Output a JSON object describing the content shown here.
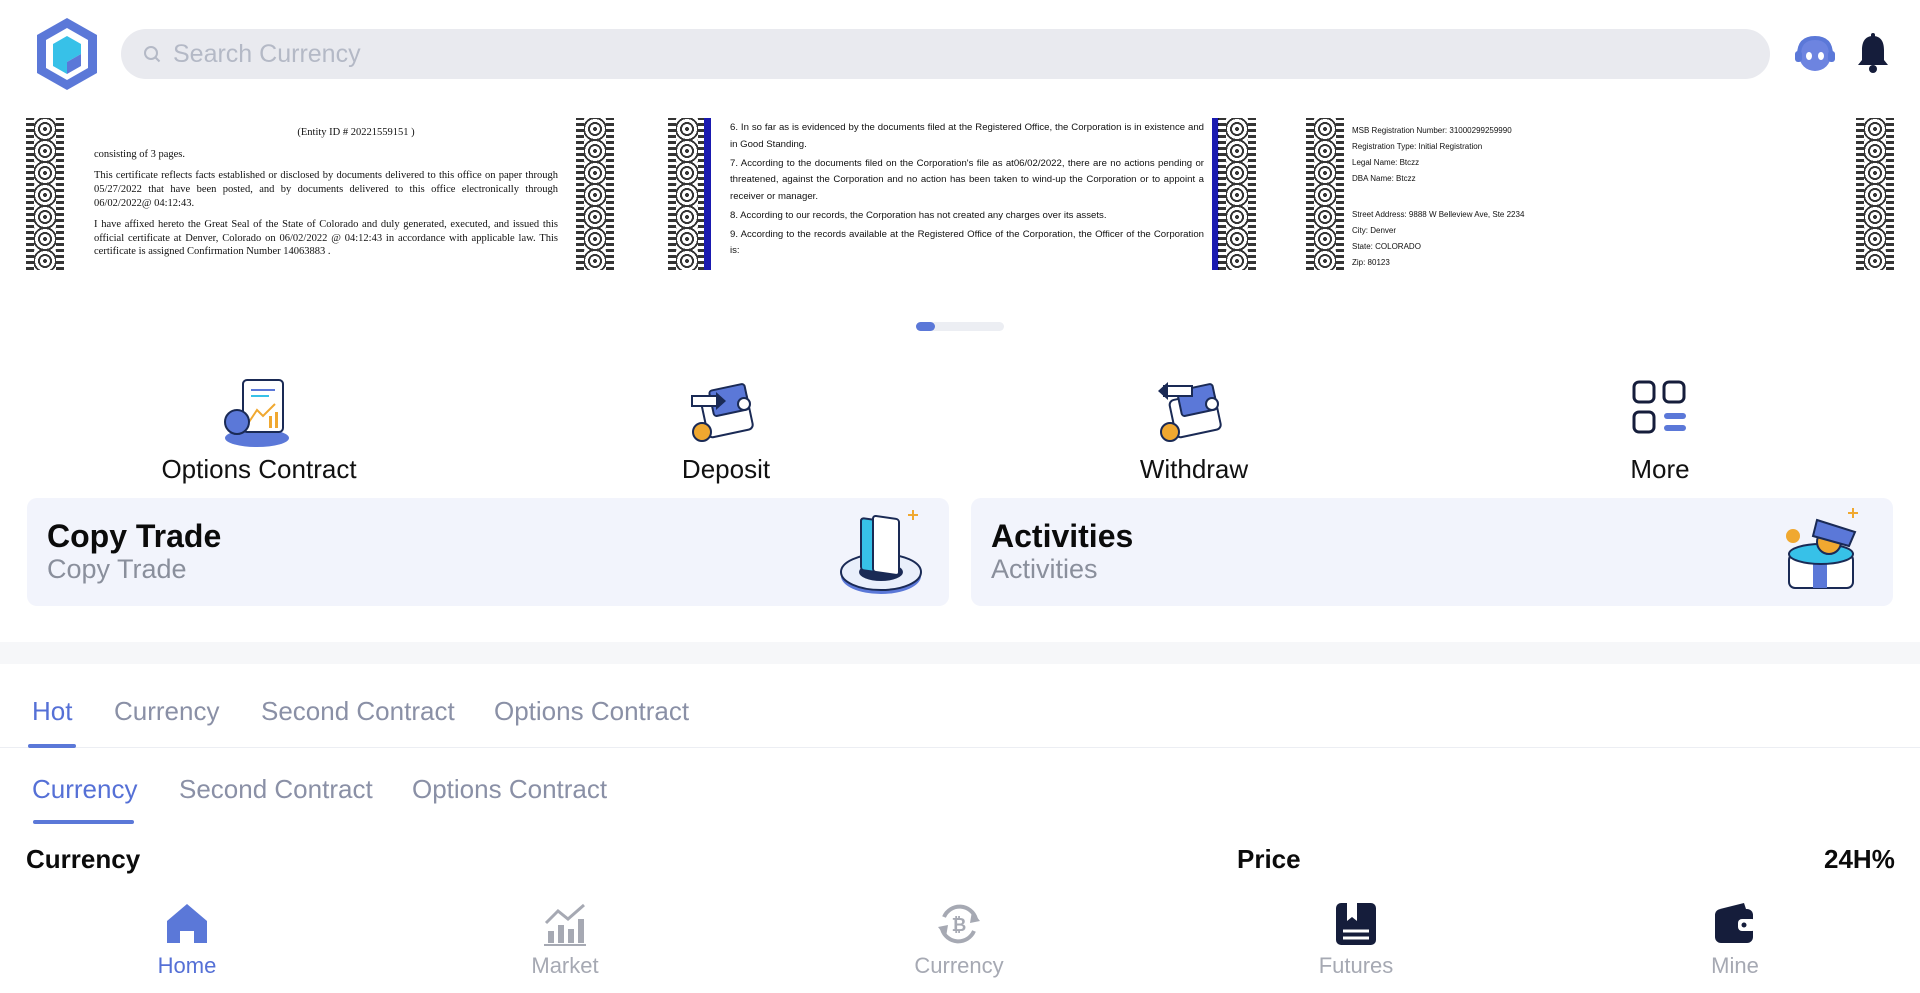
{
  "header": {
    "search_placeholder": "Search Currency"
  },
  "banner": {
    "cert1": {
      "entity_id": "(Entity ID # 20221559151 )",
      "pages": "consisting of 3 pages.",
      "para1": "This certificate reflects facts established or disclosed by documents delivered to this office on paper through 05/27/2022 that have been posted, and by documents delivered to this office electronically through 06/02/2022@ 04:12:43.",
      "para2": "I have affixed hereto the Great Seal of the State of Colorado and duly generated, executed, and issued this official certificate at Denver, Colorado on 06/02/2022 @ 04:12:43 in accordance with applicable law. This certificate is assigned Confirmation Number 14063883 ."
    },
    "cert2": {
      "item6": "6. In so far as is evidenced by the documents filed at the Registered Office, the Corporation is in existence and in Good Standing.",
      "item7": "7. According to the documents filed on the Corporation's file as at06/02/2022, there are no actions pending or threatened, against the Corporation and no action has been taken to wind-up the Corporation or to appoint a receiver or manager.",
      "item8": "8. According to our records, the Corporation has not created any charges over its assets.",
      "item9": "9. According to the records available at the Registered Office of the Corporation, the Officer of the Corporation is:"
    },
    "cert3": {
      "msb": "MSB Registration Number: 31000299259990",
      "reg_type": "Registration Type: Initial Registration",
      "legal_name": "Legal Name: Btczz",
      "dba_name": "DBA Name: Btczz",
      "street": "Street Address: 9888 W Belleview Ave, Ste 2234",
      "city": "City: Denver",
      "state": "State: COLORADO",
      "zip": "Zip: 80123"
    }
  },
  "quick_actions": [
    {
      "label": "Options Contract",
      "icon": "options-contract-icon"
    },
    {
      "label": "Deposit",
      "icon": "deposit-icon"
    },
    {
      "label": "Withdraw",
      "icon": "withdraw-icon"
    },
    {
      "label": "More",
      "icon": "more-grid-icon"
    }
  ],
  "cards": [
    {
      "title": "Copy Trade",
      "subtitle": "Copy Trade"
    },
    {
      "title": "Activities",
      "subtitle": "Activities"
    }
  ],
  "tabs": [
    "Hot",
    "Currency",
    "Second Contract",
    "Options Contract"
  ],
  "subtabs": [
    "Currency",
    "Second Contract",
    "Options Contract"
  ],
  "list_header": {
    "currency": "Currency",
    "price": "Price",
    "change": "24H%"
  },
  "bottom_nav": [
    {
      "label": "Home",
      "icon": "home-icon"
    },
    {
      "label": "Market",
      "icon": "market-chart-icon"
    },
    {
      "label": "Currency",
      "icon": "bitcoin-exchange-icon"
    },
    {
      "label": "Futures",
      "icon": "futures-book-icon"
    },
    {
      "label": "Mine",
      "icon": "wallet-icon"
    }
  ],
  "colors": {
    "accent": "#5570d6",
    "card_bg": "#f2f4fc",
    "search_bg": "#e9eaef"
  }
}
